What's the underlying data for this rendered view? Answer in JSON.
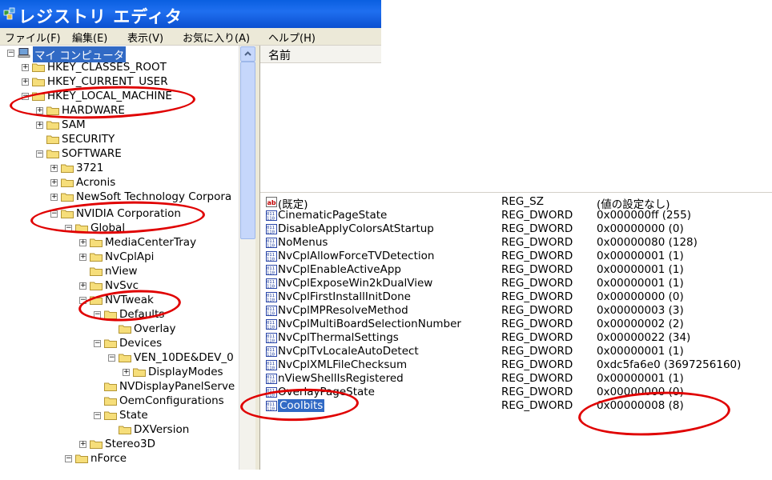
{
  "window": {
    "title": "レジストリ エディタ"
  },
  "menu": [
    "ファイル(F)",
    "編集(E)",
    "表示(V)",
    "お気に入り(A)",
    "ヘルプ(H)"
  ],
  "tree": [
    {
      "label": "マイ コンピュータ",
      "toggle": "minus",
      "icon": "computer-icon",
      "selected": true
    },
    {
      "label": "HKEY_CLASSES_ROOT",
      "toggle": "plus",
      "icon": "folder-icon"
    },
    {
      "label": "HKEY_CURRENT_USER",
      "toggle": "plus",
      "icon": "folder-icon"
    },
    {
      "label": "HKEY_LOCAL_MACHINE",
      "toggle": "minus",
      "icon": "folder-icon"
    },
    {
      "label": "HARDWARE",
      "toggle": "plus",
      "icon": "folder-icon"
    },
    {
      "label": "SAM",
      "toggle": "plus",
      "icon": "folder-icon"
    },
    {
      "label": "SECURITY",
      "toggle": "",
      "icon": "folder-icon"
    },
    {
      "label": "SOFTWARE",
      "toggle": "minus",
      "icon": "folder-icon"
    },
    {
      "label": "3721",
      "toggle": "plus",
      "icon": "folder-icon"
    },
    {
      "label": "Acronis",
      "toggle": "plus",
      "icon": "folder-icon"
    },
    {
      "label": "NewSoft Technology Corpora",
      "toggle": "plus",
      "icon": "folder-icon"
    },
    {
      "label": "NVIDIA Corporation",
      "toggle": "minus",
      "icon": "folder-icon"
    },
    {
      "label": "Global",
      "toggle": "minus",
      "icon": "folder-icon"
    },
    {
      "label": "MediaCenterTray",
      "toggle": "plus",
      "icon": "folder-icon"
    },
    {
      "label": "NvCplApi",
      "toggle": "plus",
      "icon": "folder-icon"
    },
    {
      "label": "nView",
      "toggle": "",
      "icon": "folder-icon"
    },
    {
      "label": "NvSvc",
      "toggle": "plus",
      "icon": "folder-icon"
    },
    {
      "label": "NVTweak",
      "toggle": "minus",
      "icon": "folder-icon"
    },
    {
      "label": "Defaults",
      "toggle": "minus",
      "icon": "folder-icon"
    },
    {
      "label": "Overlay",
      "toggle": "",
      "icon": "folder-icon"
    },
    {
      "label": "Devices",
      "toggle": "minus",
      "icon": "folder-icon"
    },
    {
      "label": "VEN_10DE&DEV_0",
      "toggle": "minus",
      "icon": "folder-icon"
    },
    {
      "label": "DisplayModes",
      "toggle": "plus",
      "icon": "folder-icon"
    },
    {
      "label": "NVDisplayPanelServe",
      "toggle": "",
      "icon": "folder-icon"
    },
    {
      "label": "OemConfigurations",
      "toggle": "",
      "icon": "folder-icon"
    },
    {
      "label": "State",
      "toggle": "minus",
      "icon": "folder-icon"
    },
    {
      "label": "DXVersion",
      "toggle": "",
      "icon": "folder-icon"
    },
    {
      "label": "Stereo3D",
      "toggle": "plus",
      "icon": "folder-icon"
    },
    {
      "label": "nForce",
      "toggle": "minus",
      "icon": "folder-icon"
    }
  ],
  "list_header": {
    "name": "名前"
  },
  "values": [
    {
      "name": "(既定)",
      "type": "REG_SZ",
      "data": "(値の設定なし)",
      "icon": "string-value-icon"
    },
    {
      "name": "CinematicPageState",
      "type": "REG_DWORD",
      "data": "0x000000ff (255)",
      "icon": "binary-value-icon"
    },
    {
      "name": "DisableApplyColorsAtStartup",
      "type": "REG_DWORD",
      "data": "0x00000000 (0)",
      "icon": "binary-value-icon"
    },
    {
      "name": "NoMenus",
      "type": "REG_DWORD",
      "data": "0x00000080 (128)",
      "icon": "binary-value-icon"
    },
    {
      "name": "NvCplAllowForceTVDetection",
      "type": "REG_DWORD",
      "data": "0x00000001 (1)",
      "icon": "binary-value-icon"
    },
    {
      "name": "NvCplEnableActiveApp",
      "type": "REG_DWORD",
      "data": "0x00000001 (1)",
      "icon": "binary-value-icon"
    },
    {
      "name": "NvCplExposeWin2kDualView",
      "type": "REG_DWORD",
      "data": "0x00000001 (1)",
      "icon": "binary-value-icon"
    },
    {
      "name": "NvCplFirstInstallInitDone",
      "type": "REG_DWORD",
      "data": "0x00000000 (0)",
      "icon": "binary-value-icon"
    },
    {
      "name": "NvCplMPResolveMethod",
      "type": "REG_DWORD",
      "data": "0x00000003 (3)",
      "icon": "binary-value-icon"
    },
    {
      "name": "NvCplMultiBoardSelectionNumber",
      "type": "REG_DWORD",
      "data": "0x00000002 (2)",
      "icon": "binary-value-icon"
    },
    {
      "name": "NvCplThermalSettings",
      "type": "REG_DWORD",
      "data": "0x00000022 (34)",
      "icon": "binary-value-icon"
    },
    {
      "name": "NvCplTvLocaleAutoDetect",
      "type": "REG_DWORD",
      "data": "0x00000001 (1)",
      "icon": "binary-value-icon"
    },
    {
      "name": "NvCplXMLFileChecksum",
      "type": "REG_DWORD",
      "data": "0xdc5fa6e0 (3697256160)",
      "icon": "binary-value-icon"
    },
    {
      "name": "nViewShellIsRegistered",
      "type": "REG_DWORD",
      "data": "0x00000001 (1)",
      "icon": "binary-value-icon"
    },
    {
      "name": "OverlayPageState",
      "type": "REG_DWORD",
      "data": "0x00000000 (0)",
      "icon": "binary-value-icon"
    },
    {
      "name": "Coolbits",
      "type": "REG_DWORD",
      "data": "0x00000008 (8)",
      "icon": "binary-value-icon",
      "selected": true
    }
  ],
  "colors": {
    "highlight": "#316ac5",
    "annotation": "#e00000"
  }
}
